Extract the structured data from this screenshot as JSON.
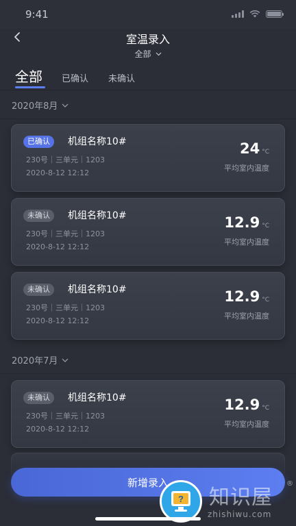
{
  "status_bar": {
    "time": "9:41"
  },
  "header": {
    "title": "室温录入",
    "filter": "全部"
  },
  "tabs": [
    {
      "label": "全部",
      "active": true
    },
    {
      "label": "已确认",
      "active": false
    },
    {
      "label": "未确认",
      "active": false
    }
  ],
  "sections": [
    {
      "month": "2020年8月",
      "cards": [
        {
          "status": "已确认",
          "status_type": "confirmed",
          "title": "机组名称10#",
          "meta": "230号｜三单元｜1203",
          "date": "2020-8-12 12:12",
          "temp": "24",
          "unit": "°C",
          "temp_label": "平均室内温度"
        },
        {
          "status": "未确认",
          "status_type": "unconfirmed",
          "title": "机组名称10#",
          "meta": "230号｜三单元｜1203",
          "date": "2020-8-12 12:12",
          "temp": "12.9",
          "unit": "°C",
          "temp_label": "平均室内温度"
        },
        {
          "status": "未确认",
          "status_type": "unconfirmed",
          "title": "机组名称10#",
          "meta": "230号｜三单元｜1203",
          "date": "2020-8-12 12:12",
          "temp": "12.9",
          "unit": "°C",
          "temp_label": "平均室内温度"
        }
      ]
    },
    {
      "month": "2020年7月",
      "cards": [
        {
          "status": "未确认",
          "status_type": "unconfirmed",
          "title": "机组名称10#",
          "meta": "230号｜三单元｜1203",
          "date": "2020-8-12 12:12",
          "temp": "12.9",
          "unit": "°C",
          "temp_label": "平均室内温度"
        }
      ]
    }
  ],
  "add_button": "新增录入",
  "watermark": {
    "text": "知识屋",
    "url": "zhishiwu.com",
    "registered": "®"
  },
  "colors": {
    "accent": "#5b7ff0",
    "background": "#2b2e37",
    "card": "#3a3e48"
  }
}
